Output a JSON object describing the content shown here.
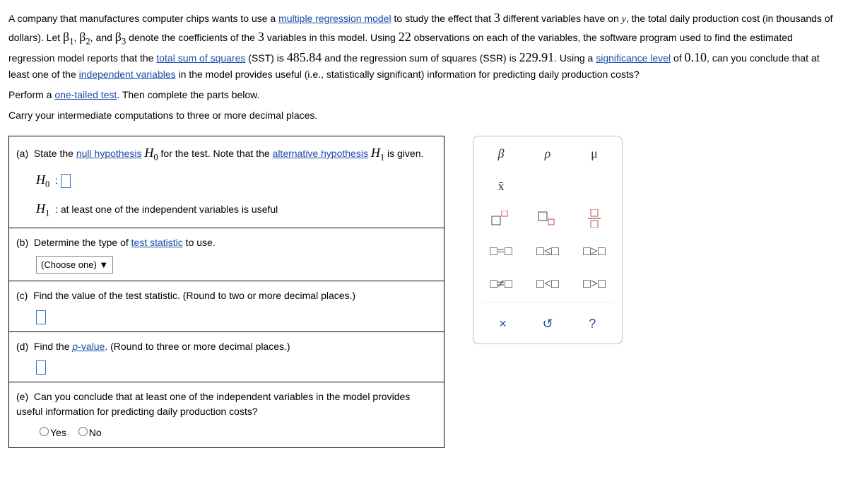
{
  "problem": {
    "p1_a": "A company that manufactures computer chips wants to use a ",
    "link_mrm": "multiple regression model",
    "p1_b": " to study the effect that ",
    "num_vars": "3",
    "p1_c": " different variables have on ",
    "yvar": "y",
    "p1_d": ", the total daily production cost (in thousands of dollars). Let ",
    "b1": "β",
    "b1sub": "1",
    "b2": "β",
    "b2sub": "2",
    "b3": "β",
    "b3sub": "3",
    "p1_e": " denote the coefficients of the ",
    "num_vars2": "3",
    "p1_f": " variables in this model. Using ",
    "n_obs": "22",
    "p1_g": " observations on each of the variables, the software program used to find the estimated regression model reports that the ",
    "link_sst": "total sum of squares",
    "p1_h": " (SST) is ",
    "sst": "485.84",
    "p1_i": " and the regression sum of squares (SSR) is ",
    "ssr": "229.91",
    "p1_j": ". Using a ",
    "link_sig": "significance level",
    "p1_k": " of ",
    "alpha": "0.10",
    "p1_l": ", can you conclude that at least one of the ",
    "link_iv": "independent variables",
    "p1_m": " in the model provides useful (i.e., statistically significant) information for predicting daily production costs?",
    "p2_a": "Perform a ",
    "link_ott": "one-tailed test",
    "p2_b": ". Then complete the parts below.",
    "p3": "Carry your intermediate computations to three or more decimal places."
  },
  "parts": {
    "a": {
      "label": "(a)",
      "text_a": "State the ",
      "link_nh": "null hypothesis",
      "text_b": " for the test. Note that the ",
      "link_ah": "alternative hypothesis",
      "text_c": " is given.",
      "H0": "H",
      "H0sub": "0",
      "H1": "H",
      "H1sub": "1",
      "H1text": "at least one of the independent variables is useful"
    },
    "b": {
      "label": "(b)",
      "text_a": "Determine the type of ",
      "link_ts": "test statistic",
      "text_b": " to use.",
      "choose": "(Choose one)"
    },
    "c": {
      "label": "(c)",
      "text": "Find the value of the test statistic. (Round to two or more decimal places.)"
    },
    "d": {
      "label": "(d)",
      "text_a": "Find the ",
      "link_p": "p",
      "text_b": "-value",
      "text_c": ". (Round to three or more decimal places.)"
    },
    "e": {
      "label": "(e)",
      "text": "Can you conclude that at least one of the independent variables in the model provides useful information for predicting daily production costs?",
      "yes": "Yes",
      "no": "No"
    }
  },
  "palette": {
    "r1": [
      "β",
      "ρ",
      "μ"
    ],
    "r2": [
      "x̄"
    ],
    "r5": [
      "□=□",
      "□≤□",
      "□≥□"
    ],
    "r6": [
      "□≠□",
      "□<□",
      "□>□"
    ],
    "footer": {
      "clear": "×",
      "reset": "↺",
      "help": "?"
    }
  }
}
